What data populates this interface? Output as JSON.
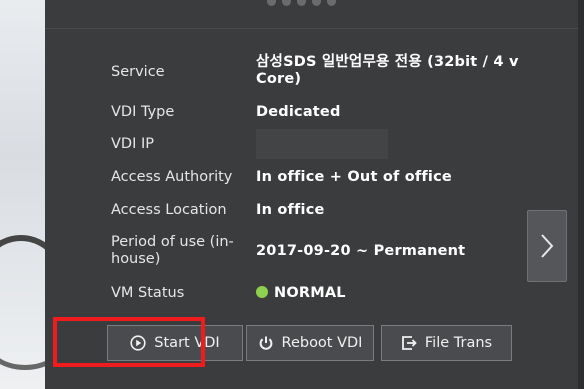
{
  "info": {
    "service_label": "Service",
    "service_value_line1": "삼성SDS 일반업무용 전용 (32bit / 4 v",
    "service_value_line2": "Core)",
    "vdi_type_label": "VDI Type",
    "vdi_type_value": "Dedicated",
    "vdi_ip_label": "VDI IP",
    "vdi_ip_value": "",
    "access_authority_label": "Access Authority",
    "access_authority_value": "In office + Out of office",
    "access_location_label": "Access Location",
    "access_location_value": "In office",
    "period_label_line1": "Period of use (in-",
    "period_label_line2": "house)",
    "period_value": "2017-09-20 ~ Permanent",
    "vm_status_label": "VM Status",
    "vm_status_value": "NORMAL"
  },
  "buttons": {
    "start_vdi": "Start VDI",
    "reboot_vdi": "Reboot VDI",
    "file_trans": "File Trans"
  },
  "colors": {
    "panel_bg": "#3b3c3e",
    "status_normal": "#8fd14f",
    "highlight": "#ee1c1c"
  },
  "icons": {
    "start": "play-circle-icon",
    "reboot": "power-icon",
    "file_trans": "file-transfer-icon",
    "next": "chevron-right-icon"
  }
}
